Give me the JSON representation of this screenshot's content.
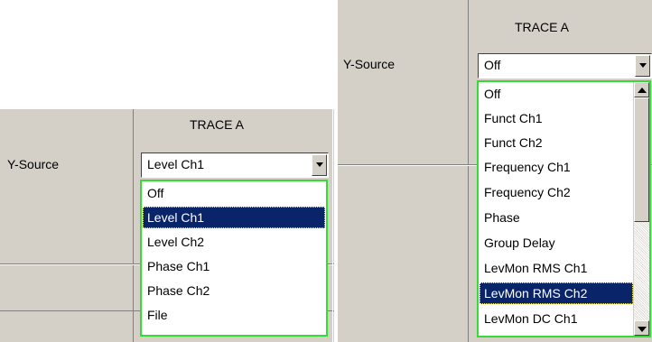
{
  "left": {
    "trace_title": "TRACE A",
    "y_source_label": "Y-Source",
    "selected_value": "Level Ch1",
    "options": [
      "Off",
      "Level Ch1",
      "Level Ch2",
      "Phase Ch1",
      "Phase Ch2",
      "File"
    ],
    "highlighted_index": 1
  },
  "right": {
    "trace_title": "TRACE A",
    "y_source_label": "Y-Source",
    "selected_value": "Off",
    "options": [
      "Off",
      "Funct Ch1",
      "Funct Ch2",
      "Frequency Ch1",
      "Frequency Ch2",
      "Phase",
      "Group Delay",
      "LevMon RMS Ch1",
      "LevMon RMS Ch2",
      "LevMon DC Ch1"
    ],
    "highlighted_index": 8
  },
  "colors": {
    "panel": "#d4d0c8",
    "dropdown_border": "#33dd33",
    "selection": "#0a246a"
  }
}
